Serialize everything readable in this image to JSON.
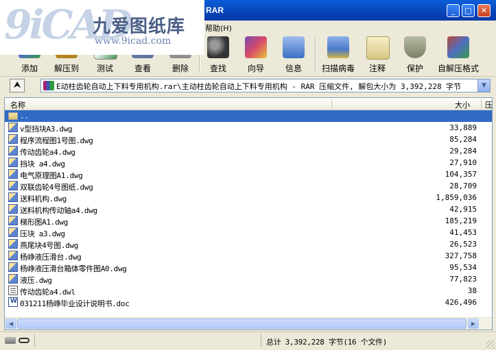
{
  "window": {
    "title": "RAR",
    "min_symbol": "_",
    "max_symbol": "□",
    "close_symbol": "✕"
  },
  "logo": {
    "mark": "9iCAD",
    "name_cn": "九爱图纸库",
    "url": "www.9icad.com"
  },
  "menu": {
    "help": "帮助(H)"
  },
  "toolbar": [
    {
      "label": "添加",
      "icon": "add-icon",
      "color": "#b24a85"
    },
    {
      "label": "解压到",
      "icon": "extract-to-icon",
      "color": "#c79b2e"
    },
    {
      "label": "测试",
      "icon": "test-icon",
      "color": "#3f8f4a"
    },
    {
      "label": "查看",
      "icon": "view-icon",
      "color": "#566d9a"
    },
    {
      "label": "删除",
      "icon": "delete-icon",
      "color": "#8a8a8a"
    },
    {
      "label": "查找",
      "icon": "find-icon",
      "color": "#5a5a5a"
    },
    {
      "label": "向导",
      "icon": "wizard-icon",
      "color": "#7a4ab0"
    },
    {
      "label": "信息",
      "icon": "info-icon",
      "color": "#3c6fc2"
    },
    {
      "label": "扫描病毒",
      "icon": "scan-virus-icon",
      "color": "#4b79c8"
    },
    {
      "label": "注释",
      "icon": "comment-icon",
      "color": "#d7c582"
    },
    {
      "label": "保护",
      "icon": "protect-icon",
      "color": "#7a7f65"
    },
    {
      "label": "自解压格式",
      "icon": "sfx-icon",
      "color": "#b8463c"
    }
  ],
  "address": {
    "up_symbol": "⮝",
    "path": "E动柱齿轮自动上下料专用机构.rar\\主动柱齿轮自动上下料专用机构 - RAR 压缩文件, 解包大小为 3,392,228 字节"
  },
  "columns": {
    "name": "名称",
    "size": "大小",
    "packed": "压"
  },
  "files": [
    {
      "name": "..",
      "size": "",
      "type": "up"
    },
    {
      "name": "v型挡块A3.dwg",
      "size": "33,889",
      "type": "dwg"
    },
    {
      "name": "程序流程图1号图.dwg",
      "size": "85,284",
      "type": "dwg"
    },
    {
      "name": "传动齿轮a4.dwg",
      "size": "29,284",
      "type": "dwg"
    },
    {
      "name": "挡块 a4.dwg",
      "size": "27,910",
      "type": "dwg"
    },
    {
      "name": "电气原理图A1.dwg",
      "size": "104,357",
      "type": "dwg"
    },
    {
      "name": "双联齿轮4号图纸.dwg",
      "size": "28,709",
      "type": "dwg"
    },
    {
      "name": "送料机构.dwg",
      "size": "1,859,036",
      "type": "dwg"
    },
    {
      "name": "送料机构传动轴a4.dwg",
      "size": "42,915",
      "type": "dwg"
    },
    {
      "name": "梯形图A1.dwg",
      "size": "185,219",
      "type": "dwg"
    },
    {
      "name": "压块 a3.dwg",
      "size": "41,453",
      "type": "dwg"
    },
    {
      "name": "燕尾块4号图.dwg",
      "size": "26,523",
      "type": "dwg"
    },
    {
      "name": "杨峥液压滑台.dwg",
      "size": "327,758",
      "type": "dwg"
    },
    {
      "name": "杨峥液压滑台箱体零件图A0.dwg",
      "size": "95,534",
      "type": "dwg"
    },
    {
      "name": "液压.dwg",
      "size": "77,823",
      "type": "dwg"
    },
    {
      "name": "传动齿轮a4.dwl",
      "size": "38",
      "type": "dwl"
    },
    {
      "name": "031211杨峥毕业设计说明书.doc",
      "size": "426,496",
      "type": "doc"
    }
  ],
  "scrollbar": {
    "left_symbol": "◀",
    "right_symbol": "▶"
  },
  "status": {
    "summary": "总计 3,392,228 字节(16 个文件)"
  }
}
